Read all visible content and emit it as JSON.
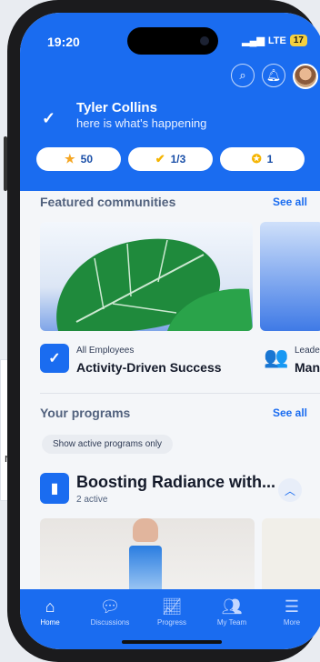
{
  "status_bar": {
    "time": "19:20",
    "network": "LTE",
    "battery": "17"
  },
  "header": {
    "user_name": "Tyler Collins",
    "greeting": "here is what's happening",
    "stats": [
      {
        "icon": "star-icon",
        "value": "50",
        "color": "#f5a623"
      },
      {
        "icon": "check-badge-icon",
        "value": "1/3",
        "color": "#f5b400"
      },
      {
        "icon": "award-ribbon-icon",
        "value": "1",
        "color": "#f5b400"
      }
    ]
  },
  "featured": {
    "title": "Featured communities",
    "see_all": "See all",
    "cards": [
      {
        "subtitle": "All Employees",
        "title": "Activity-Driven Success"
      },
      {
        "subtitle": "Leade",
        "title": "Man"
      }
    ]
  },
  "programs": {
    "title": "Your programs",
    "see_all": "See all",
    "filter_chip": "Show active programs only",
    "items": [
      {
        "title": "Boosting Radiance with...",
        "subtitle": "2 active"
      }
    ]
  },
  "background_card": {
    "text": "n"
  },
  "tabbar": {
    "items": [
      {
        "label": "Home",
        "icon": "home-icon",
        "active": true
      },
      {
        "label": "Discussions",
        "icon": "chat-icon",
        "active": false
      },
      {
        "label": "Progress",
        "icon": "chart-icon",
        "active": false
      },
      {
        "label": "My Team",
        "icon": "team-icon",
        "active": false
      },
      {
        "label": "More",
        "icon": "menu-icon",
        "active": false
      }
    ]
  },
  "colors": {
    "brand": "#1a6cf0",
    "text_dark": "#141a2a",
    "muted": "#52627e"
  }
}
